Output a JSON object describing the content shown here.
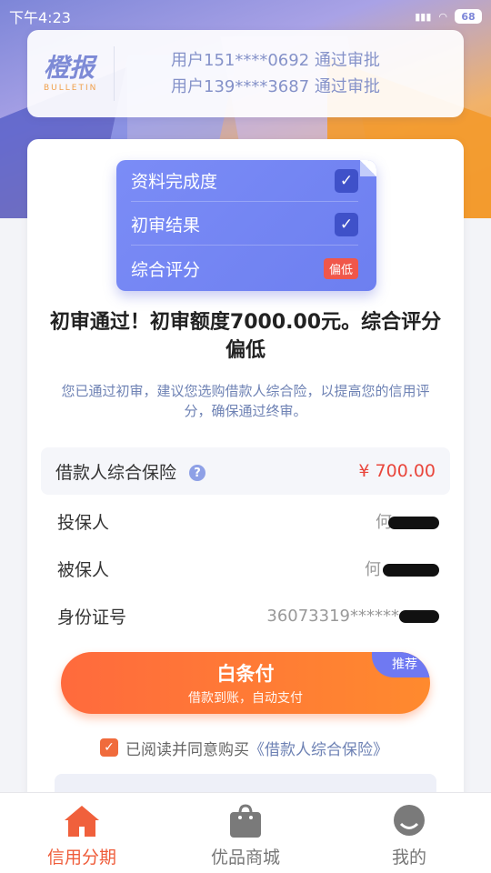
{
  "status_bar": {
    "time": "下午4:23",
    "battery": "68"
  },
  "bulletin": {
    "logo_text": "橙报",
    "logo_sub": "BULLETIN",
    "lines": [
      "用户151****0692 通过审批",
      "用户139****3687 通过审批"
    ]
  },
  "review": {
    "rows": [
      {
        "label": "资料完成度"
      },
      {
        "label": "初审结果"
      },
      {
        "label": "综合评分",
        "badge": "偏低"
      }
    ]
  },
  "headline": "初审通过！初审额度7000.00元。综合评分偏低",
  "subline": "您已通过初审，建议您选购借款人综合险，以提高您的信用评分，确保通过终审。",
  "insurance": {
    "label": "借款人综合保险",
    "price": "¥ 700.00"
  },
  "info": [
    {
      "label": "投保人",
      "value": "何"
    },
    {
      "label": "被保人",
      "value": "何"
    },
    {
      "label": "身份证号",
      "value": "36073319******"
    }
  ],
  "pay_button": {
    "title": "白条付",
    "desc": "借款到账，自动支付",
    "tag": "推荐"
  },
  "agreement": {
    "prefix": "已阅读并同意购买",
    "link": "《借款人综合保险》"
  },
  "tabs": [
    {
      "label": "信用分期",
      "icon": "house-icon",
      "active": true
    },
    {
      "label": "优品商城",
      "icon": "shopping-bag-icon",
      "active": false
    },
    {
      "label": "我的",
      "icon": "profile-icon",
      "active": false
    }
  ],
  "colors": {
    "accent": "#ef5c3a",
    "brand": "#7b8cf6",
    "price": "#e9463c"
  }
}
